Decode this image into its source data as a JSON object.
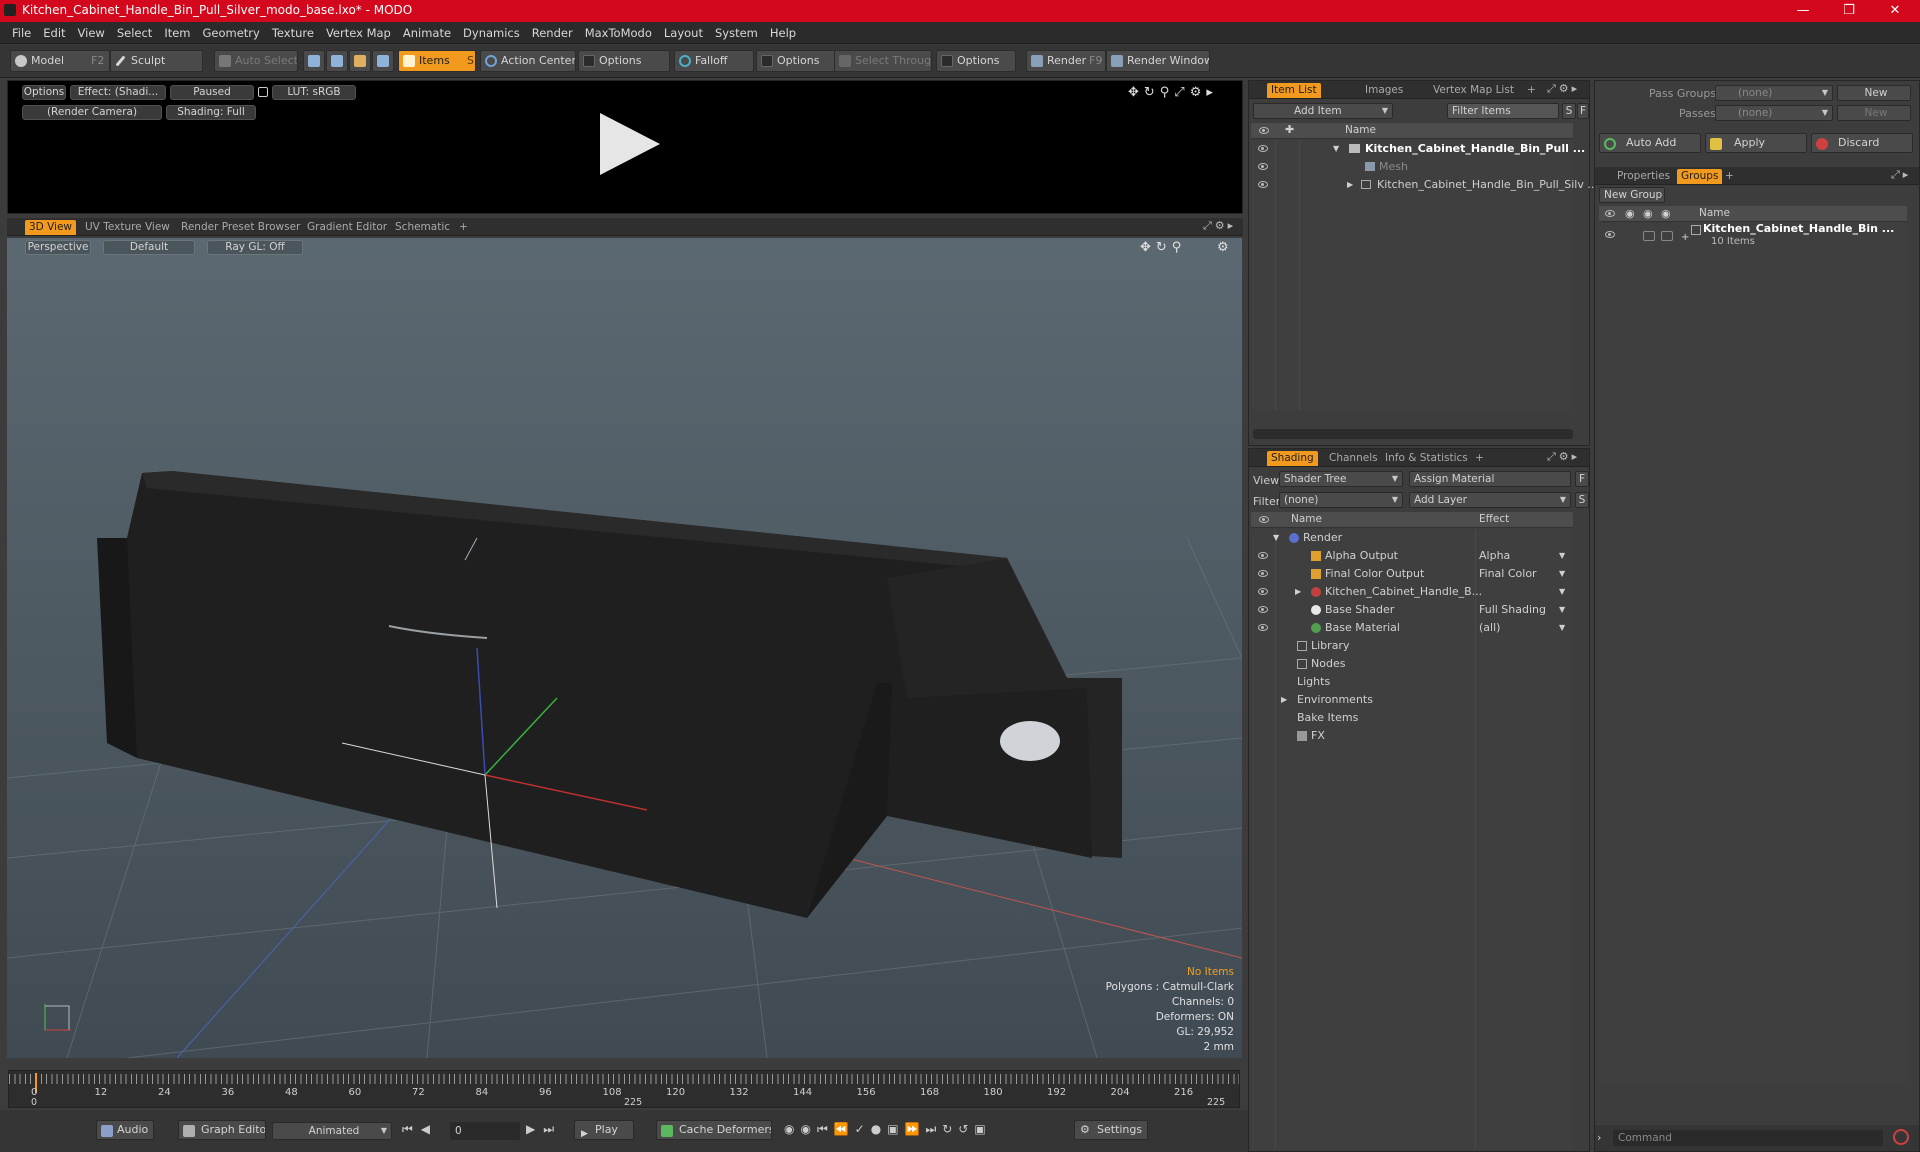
{
  "window": {
    "title": "Kitchen_Cabinet_Handle_Bin_Pull_Silver_modo_base.lxo* - MODO"
  },
  "menu": [
    "File",
    "Edit",
    "View",
    "Select",
    "Item",
    "Geometry",
    "Texture",
    "Vertex Map",
    "Animate",
    "Dynamics",
    "Render",
    "MaxToModo",
    "Layout",
    "System",
    "Help"
  ],
  "toolbar": {
    "model": "Model",
    "model_key": "F2",
    "sculpt": "Sculpt",
    "auto_select": "Auto Select",
    "items": "Items",
    "items_key": "S",
    "action_center": "Action Center",
    "options1": "Options",
    "falloff": "Falloff",
    "options2": "Options",
    "select_through": "Select Through",
    "options3": "Options",
    "render": "Render",
    "render_key": "F9",
    "render_window": "Render Window"
  },
  "render_preview": {
    "options": "Options",
    "effect": "Effect: (Shadi...",
    "paused": "Paused",
    "lut": "LUT: sRGB",
    "camera": "(Render Camera)",
    "shading": "Shading: Full"
  },
  "view_tabs": [
    "3D View",
    "UV Texture View",
    "Render Preset Browser",
    "Gradient Editor",
    "Schematic"
  ],
  "viewport": {
    "perspective": "Perspective",
    "default": "Default",
    "raygl": "Ray GL: Off",
    "stats": {
      "no_items": "No Items",
      "polygons": "Polygons : Catmull-Clark",
      "channels": "Channels: 0",
      "deformers": "Deformers: ON",
      "gl": "GL: 29,952",
      "scale": "2 mm"
    }
  },
  "item_list": {
    "tabs": [
      "Item List",
      "Images",
      "Vertex Map List"
    ],
    "add_item": "Add Item",
    "filter_items": "Filter Items",
    "col_name": "Name",
    "rows": [
      "Kitchen_Cabinet_Handle_Bin_Pull ...",
      "Mesh",
      "Kitchen_Cabinet_Handle_Bin_Pull_Silv ..."
    ]
  },
  "shading": {
    "tabs": [
      "Shading",
      "Channels",
      "Info & Statistics"
    ],
    "view_label": "View",
    "view_value": "Shader Tree",
    "assign_material": "Assign Material",
    "filter_label": "Filter",
    "filter_value": "(none)",
    "add_layer": "Add Layer",
    "col_name": "Name",
    "col_effect": "Effect",
    "rows": [
      {
        "name": "Render",
        "effect": ""
      },
      {
        "name": "Alpha Output",
        "effect": "Alpha"
      },
      {
        "name": "Final Color Output",
        "effect": "Final Color"
      },
      {
        "name": "Kitchen_Cabinet_Handle_B...",
        "effect": ""
      },
      {
        "name": "Base Shader",
        "effect": "Full Shading"
      },
      {
        "name": "Base Material",
        "effect": "(all)"
      },
      {
        "name": "Library",
        "effect": ""
      },
      {
        "name": "Nodes",
        "effect": ""
      },
      {
        "name": "Lights",
        "effect": ""
      },
      {
        "name": "Environments",
        "effect": ""
      },
      {
        "name": "Bake Items",
        "effect": ""
      },
      {
        "name": "FX",
        "effect": ""
      }
    ]
  },
  "groups": {
    "pass_groups": "Pass Groups",
    "passes": "Passes",
    "none1": "(none)",
    "none2": "(none)",
    "new1": "New",
    "new2": "New",
    "auto_add": "Auto Add",
    "apply": "Apply",
    "discard": "Discard",
    "tabs": [
      "Properties",
      "Groups"
    ],
    "new_group": "New Group",
    "col_name": "Name",
    "item_name": "Kitchen_Cabinet_Handle_Bin ...",
    "item_count": "10 Items"
  },
  "timeline": {
    "ticks": [
      "0",
      "12",
      "24",
      "36",
      "48",
      "60",
      "72",
      "84",
      "96",
      "108",
      "120",
      "132",
      "144",
      "156",
      "168",
      "180",
      "192",
      "204",
      "216"
    ],
    "start": "0",
    "mid": "225",
    "end": "225"
  },
  "bottom": {
    "audio": "Audio",
    "graph_editor": "Graph Editor",
    "animated": "Animated",
    "frame": "0",
    "play": "Play",
    "cache_deformers": "Cache Deformers",
    "settings": "Settings",
    "command": "Command"
  },
  "colors": {
    "accent": "#f29a1e",
    "titlebar": "#d4081c"
  }
}
